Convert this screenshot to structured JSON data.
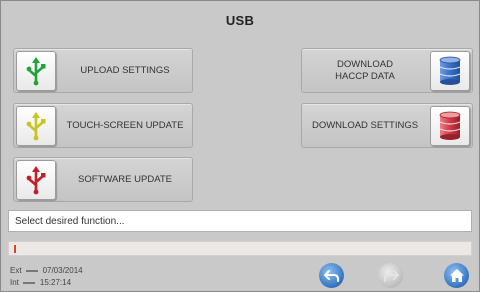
{
  "title": "USB",
  "buttons": {
    "upload_settings": "UPLOAD SETTINGS",
    "touch_screen_update": "TOUCH-SCREEN UPDATE",
    "software_update": "SOFTWARE UPDATE",
    "download_haccp_line1": "DOWNLOAD",
    "download_haccp_line2": "HACCP DATA",
    "download_settings": "DOWNLOAD SETTINGS"
  },
  "icons": {
    "upload_settings": "usb-icon",
    "touch_screen_update": "usb-icon",
    "software_update": "usb-icon",
    "download_haccp": "database-icon",
    "download_settings": "database-icon",
    "back": "back-arrow-icon",
    "forward": "forward-arrow-icon",
    "home": "home-icon"
  },
  "colors": {
    "usb_green": "#22a33a",
    "usb_yellow": "#c8c420",
    "usb_red": "#c0202a",
    "db_blue": "#3a6fc4",
    "db_red": "#d03a45",
    "nav_blue": "#3f7fc8",
    "progress_fill": "#d6452a"
  },
  "message": "Select desired function...",
  "progress_value": 0,
  "status": {
    "ext_label": "Ext",
    "ext_value": "07/03/2014",
    "int_label": "Int",
    "int_value": "15:27:14"
  }
}
